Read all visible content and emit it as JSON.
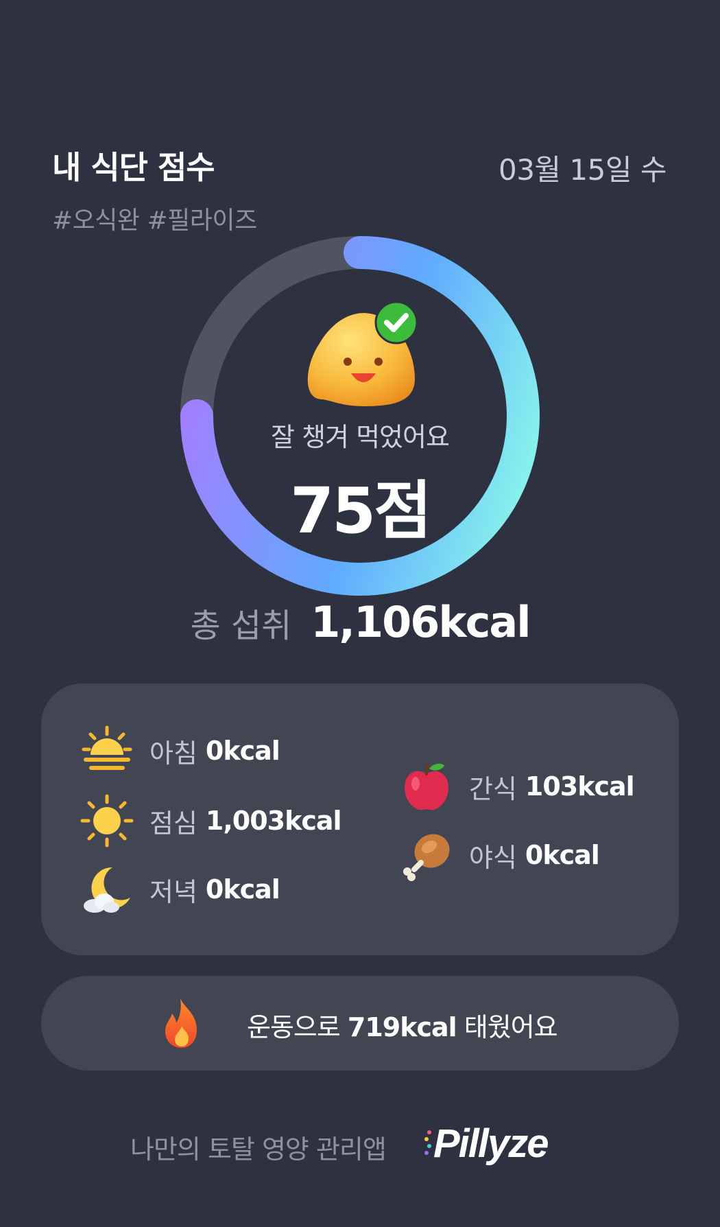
{
  "header": {
    "title": "내 식단 점수",
    "date": "03월 15일 수",
    "tags": "#오식완 #필라이즈"
  },
  "score": {
    "message": "잘 챙겨 먹었어요",
    "value": "75점",
    "ring_fraction": 0.75,
    "gradient": [
      "#a080ff",
      "#60aaff",
      "#86f0ec"
    ],
    "track_color": "#505462"
  },
  "total": {
    "label": "총 섭취",
    "value": "1,106kcal"
  },
  "meals": {
    "breakfast": {
      "icon": "sunrise-icon",
      "name": "아침",
      "kcal": "0kcal"
    },
    "lunch": {
      "icon": "sun-icon",
      "name": "점심",
      "kcal": "1,003kcal"
    },
    "dinner": {
      "icon": "moon-cloud-icon",
      "name": "저녁",
      "kcal": "0kcal"
    },
    "snack": {
      "icon": "apple-icon",
      "name": "간식",
      "kcal": "103kcal"
    },
    "late_night": {
      "icon": "chicken-leg-icon",
      "name": "야식",
      "kcal": "0kcal"
    }
  },
  "exercise": {
    "icon": "fire-icon",
    "prefix": "운동으로 ",
    "value": "719kcal",
    "suffix": " 태웠어요"
  },
  "footer": {
    "tagline": "나만의 토탈 영양 관리앱",
    "brand": "Pillyze"
  }
}
